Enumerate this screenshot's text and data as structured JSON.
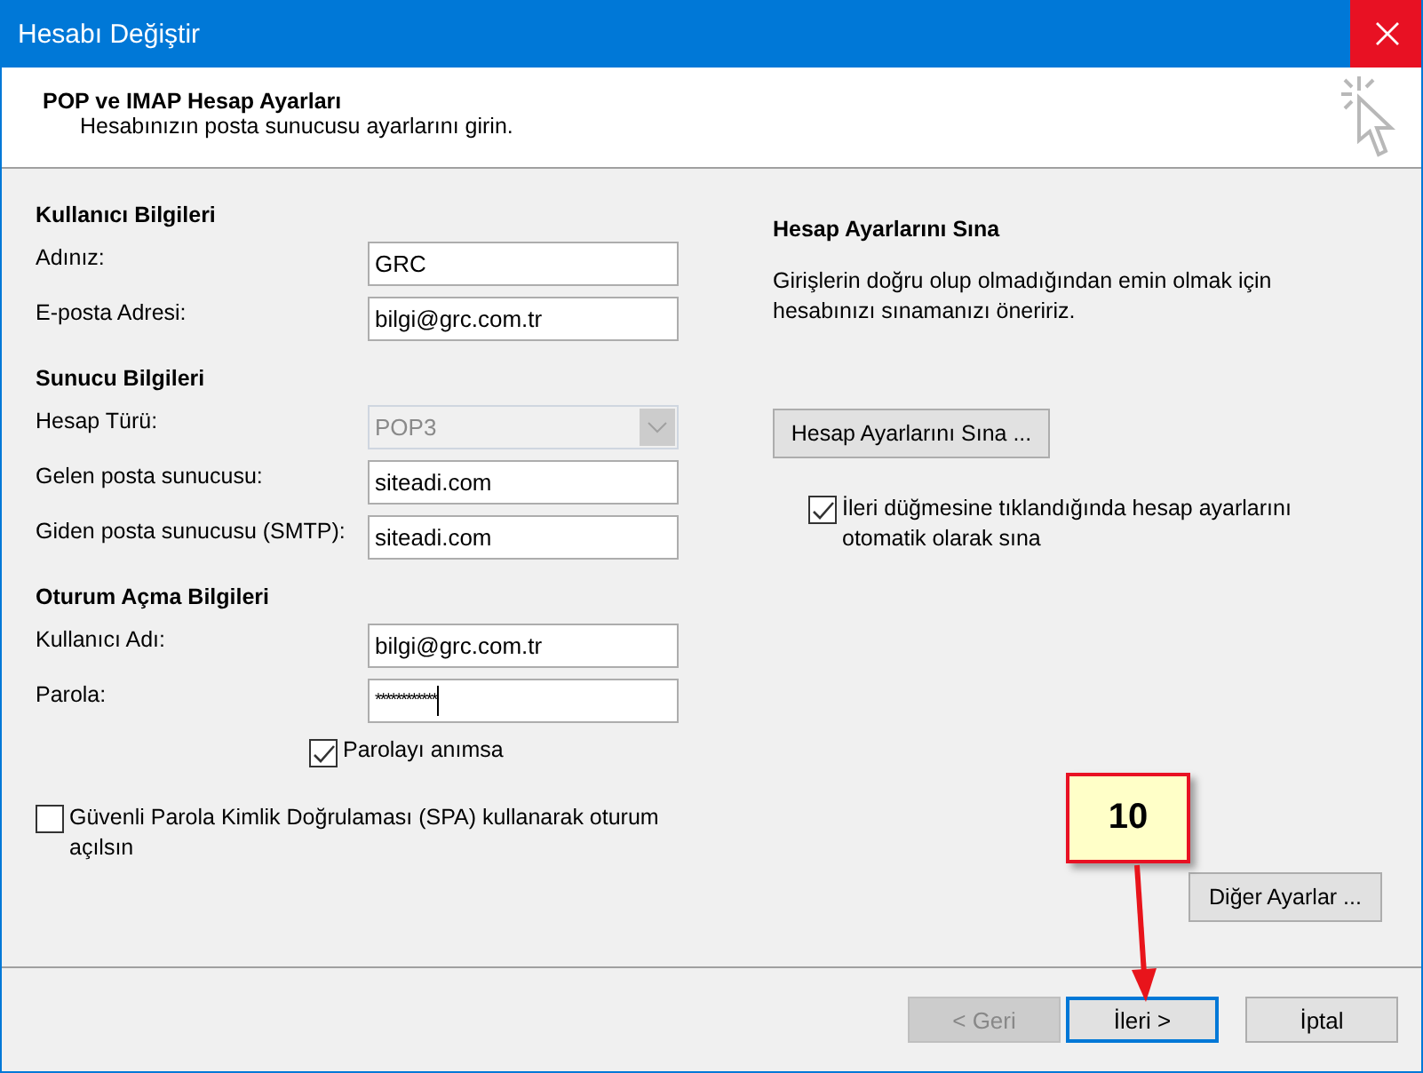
{
  "window": {
    "title": "Hesabı Değiştir"
  },
  "header": {
    "title": "POP ve IMAP Hesap Ayarları",
    "subtitle": "Hesabınızın posta sunucusu ayarlarını girin."
  },
  "left_groups": [
    {
      "heading": "Kullanıcı Bilgileri",
      "fields": [
        {
          "label": "Adınız:",
          "kind": "text",
          "value": "GRC",
          "disabled": false
        },
        {
          "label": "E-posta Adresi:",
          "kind": "text",
          "value": "bilgi@grc.com.tr",
          "disabled": false
        }
      ]
    },
    {
      "heading": "Sunucu Bilgileri",
      "fields": [
        {
          "label": "Hesap Türü:",
          "kind": "dropdown",
          "value": "POP3",
          "disabled": true
        },
        {
          "label": "Gelen posta sunucusu:",
          "kind": "text",
          "value": "siteadi.com",
          "disabled": false
        },
        {
          "label": "Giden posta sunucusu (SMTP):",
          "kind": "text",
          "value": "siteadi.com",
          "disabled": false
        }
      ]
    },
    {
      "heading": "Oturum Açma Bilgileri",
      "fields": [
        {
          "label": "Kullanıcı Adı:",
          "kind": "text",
          "value": "bilgi@grc.com.tr",
          "disabled": false
        },
        {
          "label": "Parola:",
          "kind": "password",
          "value": "************",
          "disabled": false
        }
      ]
    }
  ],
  "remember_password": {
    "label": "Parolayı anımsa",
    "checked": true
  },
  "spa": {
    "label": "Güvenli Parola Kimlik Doğrulaması (SPA) kullanarak oturum açılsın",
    "checked": false
  },
  "test": {
    "heading": "Hesap Ayarlarını Sına",
    "description": "Girişlerin doğru olup olmadığından emin olmak için hesabınızı sınamanızı öneririz.",
    "button": "Hesap Ayarlarını Sına ...",
    "auto_test": {
      "label": "İleri düğmesine tıklandığında hesap ayarlarını otomatik olarak sına",
      "checked": true
    }
  },
  "more_settings_button": "Diğer Ayarlar ...",
  "callout": {
    "label": "10"
  },
  "buttons": [
    {
      "label": "< Geri",
      "disabled": true,
      "focused": false
    },
    {
      "label": "İleri >",
      "disabled": false,
      "focused": true
    },
    {
      "label": "İptal",
      "disabled": false,
      "focused": false
    }
  ]
}
